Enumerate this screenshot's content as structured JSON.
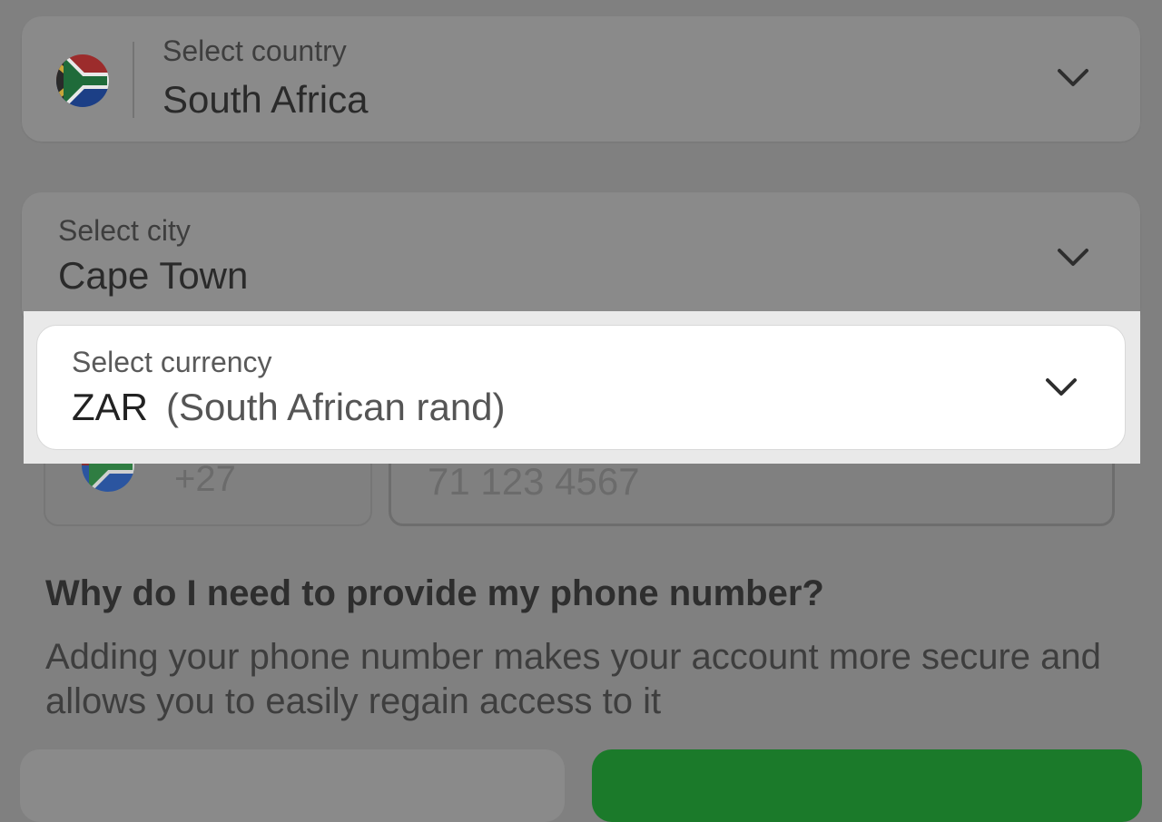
{
  "country": {
    "label": "Select country",
    "value": "South Africa",
    "flag": "south-africa-flag"
  },
  "city": {
    "label": "Select city",
    "value": "Cape Town"
  },
  "currency": {
    "label": "Select currency",
    "code": "ZAR",
    "name": "(South African rand)"
  },
  "phone": {
    "code": "+27",
    "placeholder": "71 123 4567"
  },
  "info": {
    "question": "Why do I need to provide my phone number?",
    "answer": "Adding your phone number makes your account more secure and allows you to easily regain access to it"
  },
  "colors": {
    "overlay": "#808080",
    "primary": "#1b7a2a",
    "highlight": "#ffffff"
  }
}
